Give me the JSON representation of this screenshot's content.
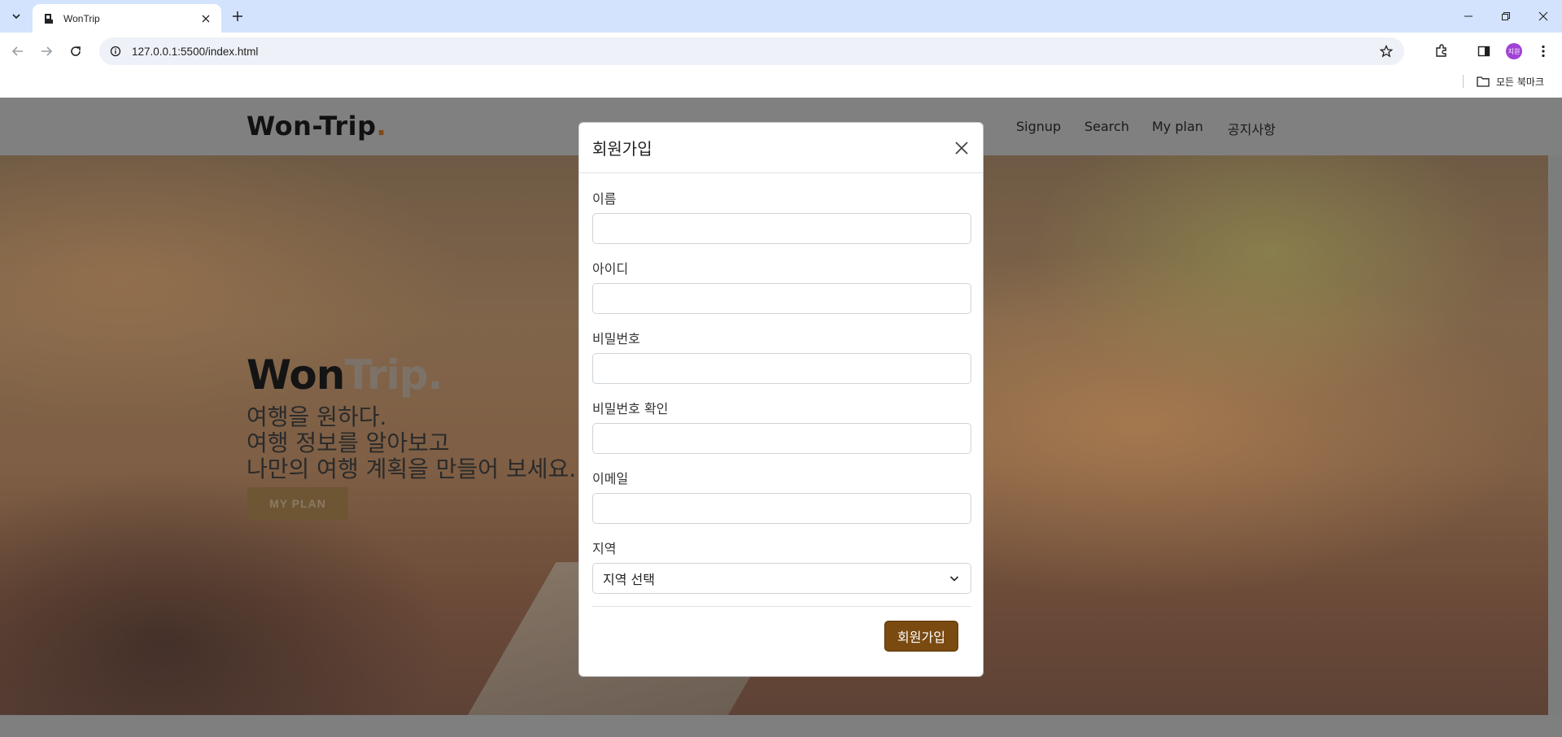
{
  "browser": {
    "tab_title": "WonTrip",
    "url": "127.0.0.1:5500/index.html",
    "bookmarks_label": "모든 북마크",
    "profile_initials": "지원"
  },
  "site": {
    "brand_main": "Won-Trip",
    "brand_dot": ".",
    "nav": [
      "Signup",
      "Search",
      "My plan",
      "공지사항"
    ]
  },
  "hero": {
    "title_main": "Won",
    "title_accent": "Trip.",
    "lines": [
      "여행을 원하다.",
      "여행 정보를 알아보고",
      "나만의 여행 계획을 만들어 보세요."
    ],
    "button": "MY PLAN"
  },
  "modal": {
    "title": "회원가입",
    "fields": [
      {
        "label": "이름",
        "value": ""
      },
      {
        "label": "아이디",
        "value": ""
      },
      {
        "label": "비밀번호",
        "value": ""
      },
      {
        "label": "비밀번호 확인",
        "value": ""
      },
      {
        "label": "이메일",
        "value": ""
      },
      {
        "label": "지역",
        "value": "지역 선택"
      }
    ],
    "submit": "회원가입"
  },
  "colors": {
    "accent": "#7a4a10",
    "tabstrip": "#d3e3fd",
    "overlay": "#808080"
  },
  "icons": [
    "tab-search-icon",
    "favicon-icon",
    "close-tab-icon",
    "plus-icon",
    "minimize-icon",
    "restore-icon",
    "close-window-icon",
    "back-icon",
    "forward-icon",
    "reload-icon",
    "site-info-icon",
    "star-icon",
    "extensions-icon",
    "side-panel-icon",
    "kebab-menu-icon",
    "folder-icon",
    "close-icon",
    "chevron-down-icon"
  ]
}
